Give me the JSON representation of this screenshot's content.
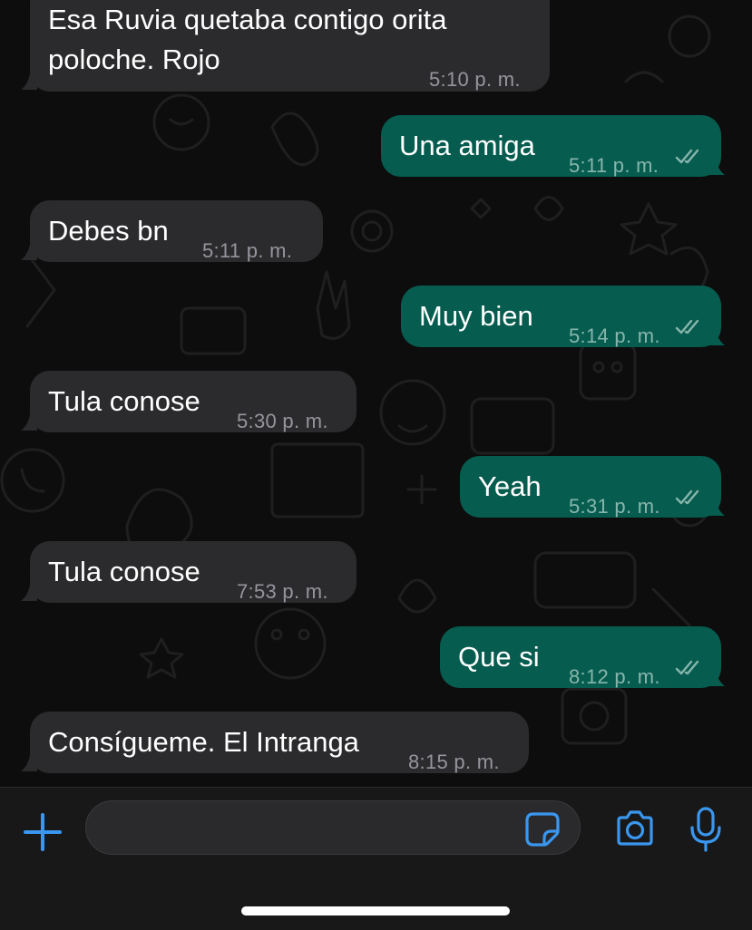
{
  "messages": [
    {
      "direction": "in",
      "text_lines": [
        "Esa Ruvia quetaba  contigo orita",
        "poloche. Rojo"
      ],
      "time": "5:10 p. m."
    },
    {
      "direction": "out",
      "text": "Una amiga",
      "time": "5:11 p. m.",
      "status": "read"
    },
    {
      "direction": "in",
      "text": "Debes bn",
      "time": "5:11 p. m."
    },
    {
      "direction": "out",
      "text": "Muy bien",
      "time": "5:14 p. m.",
      "status": "read"
    },
    {
      "direction": "in",
      "text": "Tula conose",
      "time": "5:30 p. m."
    },
    {
      "direction": "out",
      "text": "Yeah",
      "time": "5:31 p. m.",
      "status": "read"
    },
    {
      "direction": "in",
      "text": "Tula conose",
      "time": "7:53 p. m."
    },
    {
      "direction": "out",
      "text": "Que si",
      "time": "8:12 p. m.",
      "status": "read"
    },
    {
      "direction": "in",
      "text": "Consígueme. El Intranga",
      "time": "8:15 p. m."
    }
  ],
  "composer": {
    "placeholder": "",
    "value": "",
    "icons": {
      "attach": "plus-icon",
      "sticker": "sticker-icon",
      "camera": "camera-icon",
      "microphone": "microphone-icon"
    }
  },
  "colors": {
    "incoming_bubble": "#2b2b2d",
    "outgoing_bubble": "#065c4e",
    "accent": "#3a97f0",
    "background": "#0d0d0d"
  }
}
